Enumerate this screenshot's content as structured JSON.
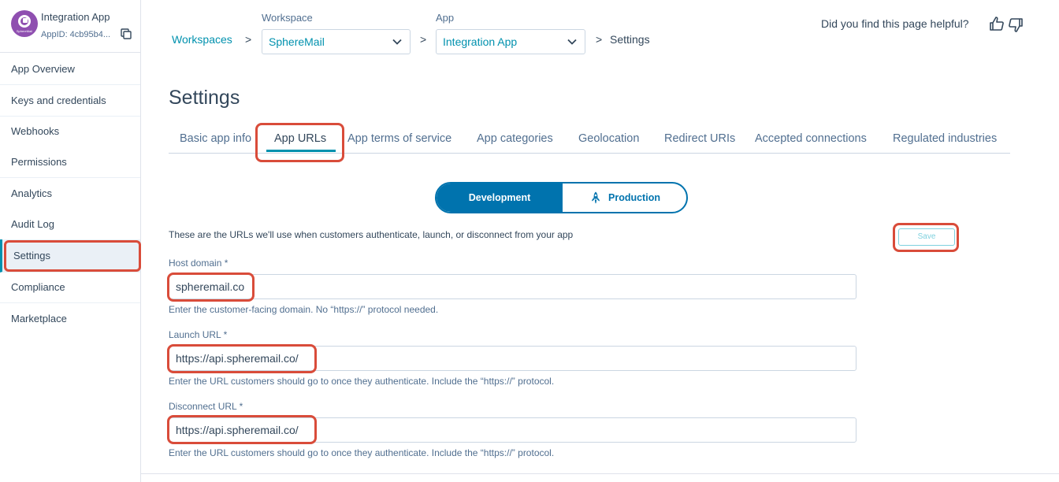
{
  "app": {
    "name": "Integration App",
    "app_id": "AppID: 4cb95b4...",
    "logo_text": "SphereMail"
  },
  "sidebar": {
    "items": [
      {
        "label": "App Overview"
      },
      {
        "label": "Keys and credentials"
      },
      {
        "label": "Webhooks"
      },
      {
        "label": "Permissions"
      },
      {
        "label": "Analytics"
      },
      {
        "label": "Audit Log"
      },
      {
        "label": "Settings",
        "active": true
      },
      {
        "label": "Compliance"
      },
      {
        "label": "Marketplace"
      }
    ]
  },
  "breadcrumb": {
    "workspaces_link": "Workspaces",
    "workspace_label": "Workspace",
    "workspace_value": "SphereMail",
    "app_label": "App",
    "app_value": "Integration App",
    "current": "Settings",
    "separator": ">"
  },
  "feedback": {
    "question": "Did you find this page helpful?"
  },
  "page": {
    "title": "Settings"
  },
  "tabs": [
    {
      "label": "Basic app info"
    },
    {
      "label": "App URLs",
      "active": true
    },
    {
      "label": "App terms of service"
    },
    {
      "label": "App categories"
    },
    {
      "label": "Geolocation"
    },
    {
      "label": "Redirect URIs"
    },
    {
      "label": "Accepted connections"
    },
    {
      "label": "Regulated industries"
    }
  ],
  "environment_toggle": {
    "development": "Development",
    "production": "Production",
    "selected": "Development"
  },
  "form": {
    "description": "These are the URLs we'll use when customers authenticate, launch, or disconnect from your app",
    "save_label": "Save",
    "host_domain": {
      "label": "Host domain *",
      "value": "spheremail.co",
      "help": "Enter the customer-facing domain. No “https://” protocol needed."
    },
    "launch_url": {
      "label": "Launch URL *",
      "value": "https://api.spheremail.co/",
      "help": "Enter the URL customers should go to once they authenticate. Include the “https://” protocol."
    },
    "disconnect_url": {
      "label": "Disconnect URL *",
      "value": "https://api.spheremail.co/",
      "help": "Enter the URL customers should go to once they authenticate. Include the “https://” protocol."
    }
  },
  "colors": {
    "accent": "#0091ae",
    "toggle": "#0073ae",
    "highlight": "#d94c3a",
    "logo": "#8f4fb0"
  }
}
